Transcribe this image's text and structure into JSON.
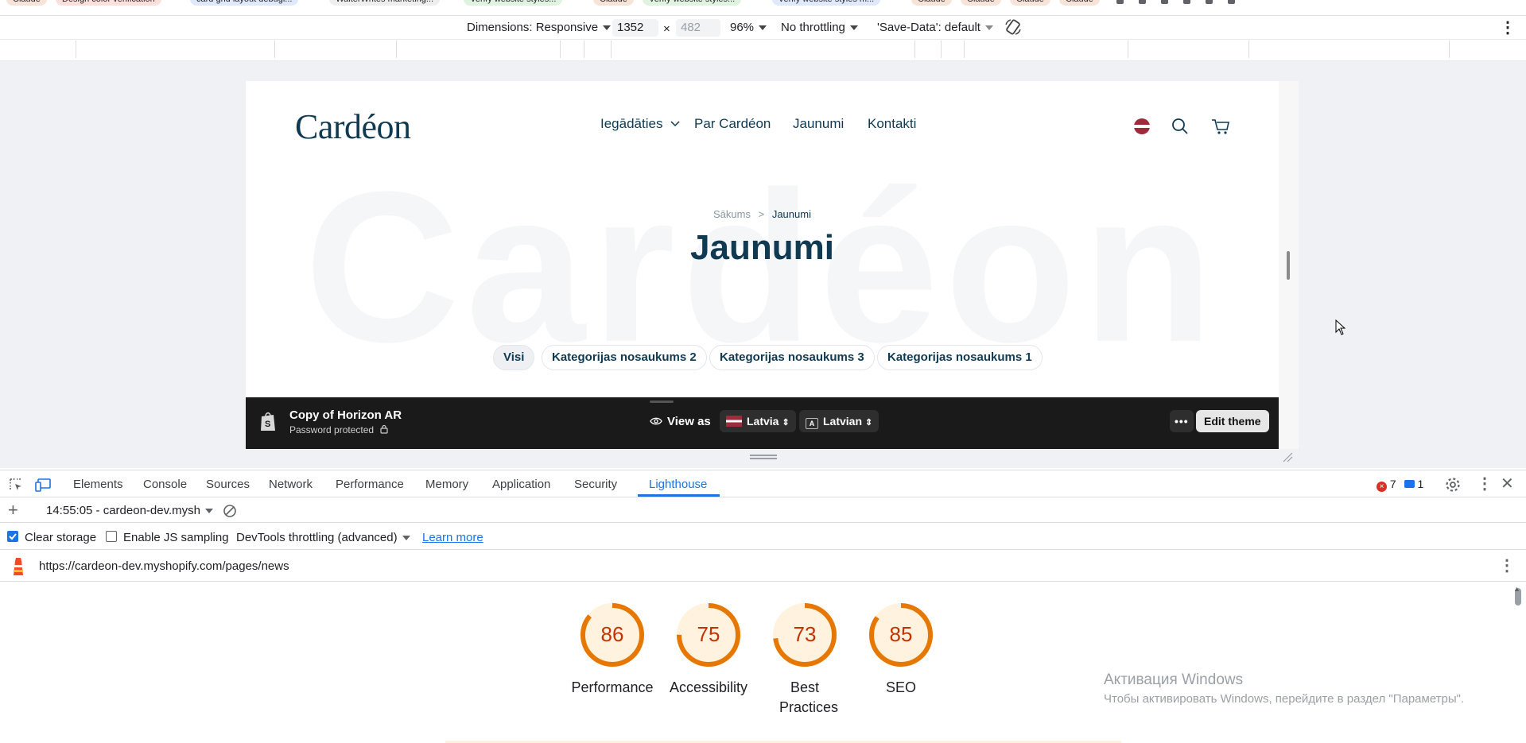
{
  "tabstrip": {
    "chips": [
      {
        "label": "Claude",
        "color": "#f8e3d8"
      },
      {
        "label": "Design color verification",
        "color": "#fde0dc"
      },
      {
        "label": "card grid layout debugi...",
        "color": "#dfe9fb"
      },
      {
        "label": "WalterWrites marketing...",
        "color": "#eeeeee"
      },
      {
        "label": "Verify website styles...",
        "color": "#dff3e0"
      },
      {
        "label": "Claude",
        "color": "#f8e3d8"
      },
      {
        "label": "Verify website styles...",
        "color": "#dff3e0"
      },
      {
        "label": "Verify website styles m...",
        "color": "#dfe9fb"
      },
      {
        "label": "Claude",
        "color": "#f8e3d8"
      },
      {
        "label": "Claude",
        "color": "#f8e3d8"
      },
      {
        "label": "Claude",
        "color": "#f8e3d8"
      },
      {
        "label": "Claude",
        "color": "#f8e3d8"
      }
    ]
  },
  "device_toolbar": {
    "dimensions_label": "Dimensions: Responsive",
    "width_value": "1352",
    "times": "×",
    "height_value": "482",
    "zoom": "96%",
    "throttling": "No throttling",
    "save_data": "'Save-Data': default"
  },
  "site": {
    "logo": "Cardéon",
    "nav": [
      "Iegādāties",
      "Par Cardéon",
      "Jaunumi",
      "Kontakti"
    ],
    "watermark": "Cardéon",
    "breadcrumb_home": "Sākums",
    "breadcrumb_sep": ">",
    "breadcrumb_current": "Jaunumi",
    "title": "Jaunumi",
    "filters": [
      "Visi",
      "Kategorijas nosaukums 2",
      "Kategorijas nosaukums 3",
      "Kategorijas nosaukums 1"
    ]
  },
  "shopify_bar": {
    "theme_name": "Copy of Horizon AR",
    "status": "Password protected",
    "view_as": "View as",
    "country": "Latvia",
    "language": "Latvian",
    "edit_theme": "Edit theme"
  },
  "devtools": {
    "tabs": [
      "Elements",
      "Console",
      "Sources",
      "Network",
      "Performance",
      "Memory",
      "Application",
      "Security",
      "Lighthouse"
    ],
    "active_tab": "Lighthouse",
    "error_count": "7",
    "message_count": "1",
    "report_selector": "14:55:05 - cardeon-dev.mysh",
    "clear_storage": "Clear storage",
    "enable_js_sampling": "Enable JS sampling",
    "throttling": "DevTools throttling (advanced)",
    "learn_more": "Learn more",
    "url": "https://cardeon-dev.myshopify.com/pages/news"
  },
  "scores": [
    {
      "label": "Performance",
      "value": 86
    },
    {
      "label": "Accessibility",
      "value": 75
    },
    {
      "label": "Best Practices",
      "value": 73
    },
    {
      "label": "SEO",
      "value": 85
    }
  ],
  "colors": {
    "score_average": "#e67700",
    "score_track": "#fff3e0",
    "brand": "#0f3a52",
    "devtools_accent": "#1a73e8"
  },
  "windows_activation": {
    "title": "Активация Windows",
    "subtitle": "Чтобы активировать Windows, перейдите в раздел \"Параметры\"."
  }
}
